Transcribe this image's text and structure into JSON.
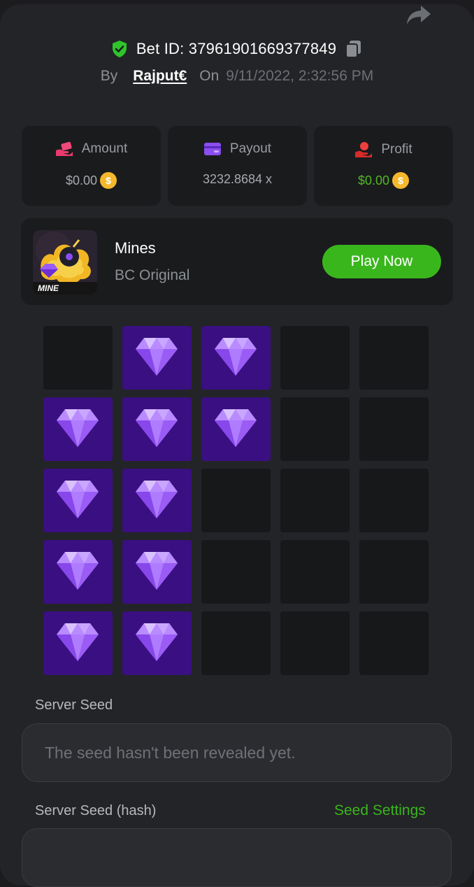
{
  "header": {
    "bet_id_label": "Bet ID: 37961901669377849",
    "by_label": "By",
    "username": "Rajput€",
    "on_label": "On",
    "date": "9/11/2022, 2:32:56 PM"
  },
  "stats": [
    {
      "label": "Amount",
      "value": "$0.00",
      "icon": "wallet-hand-icon",
      "coin": "$"
    },
    {
      "label": "Payout",
      "value": "3232.8684 x",
      "icon": "card-icon"
    },
    {
      "label": "Profit",
      "value": "$0.00",
      "icon": "profit-hand-icon",
      "coin": "$"
    }
  ],
  "game": {
    "thumb_label": "MINE",
    "name": "Mines",
    "provider": "BC Original",
    "play_label": "Play Now"
  },
  "board": {
    "rows": 5,
    "cols": 5,
    "tiles": [
      "empty",
      "gem",
      "gem",
      "empty",
      "empty",
      "gem",
      "gem",
      "gem",
      "empty",
      "empty",
      "gem",
      "gem",
      "empty",
      "empty",
      "empty",
      "gem",
      "gem",
      "empty",
      "empty",
      "empty",
      "gem",
      "gem",
      "empty",
      "empty",
      "empty"
    ]
  },
  "seeds": {
    "server_seed_label": "Server Seed",
    "server_seed_value": "The seed hasn't been revealed yet.",
    "server_seed_hash_label": "Server Seed (hash)",
    "seed_settings_label": "Seed Settings"
  },
  "colors": {
    "accent_green": "#3ab61d",
    "gem_tile": "#3a0f82",
    "empty_tile": "#17181a"
  }
}
